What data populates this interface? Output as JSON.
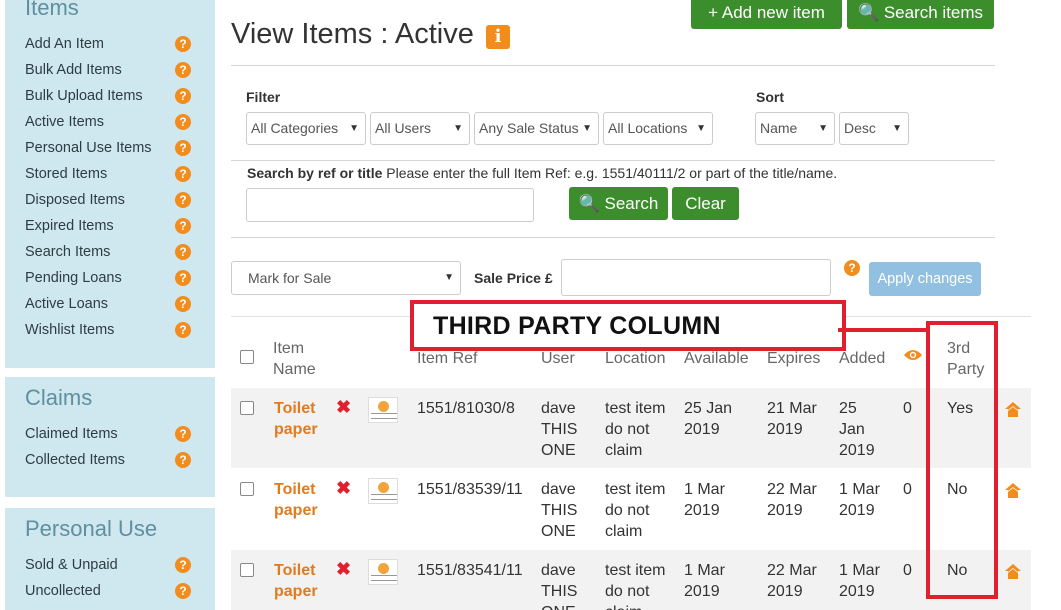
{
  "sidebar": {
    "items_title": "Items",
    "items": [
      "Add An Item",
      "Bulk Add Items",
      "Bulk Upload Items",
      "Active Items",
      "Personal Use Items",
      "Stored Items",
      "Disposed Items",
      "Expired Items",
      "Search Items",
      "Pending Loans",
      "Active Loans",
      "Wishlist Items"
    ],
    "claims_title": "Claims",
    "claims": [
      "Claimed Items",
      "Collected Items"
    ],
    "personal_title": "Personal Use",
    "personal": [
      "Sold & Unpaid",
      "Uncollected"
    ],
    "help_glyph": "?"
  },
  "header": {
    "title": "View Items : Active",
    "info_glyph": "i",
    "add_button": "+ Add new item",
    "search_button": "🔍 Search items"
  },
  "filter": {
    "label": "Filter",
    "categories": "All Categories",
    "users": "All Users",
    "sale_status": "Any Sale Status",
    "locations": "All Locations"
  },
  "sort": {
    "label": "Sort",
    "field": "Name",
    "direction": "Desc"
  },
  "search": {
    "label": "Search by ref or title",
    "hint": " Please enter the full Item Ref: e.g. 1551/40111/2 or part of the title/name.",
    "value": "",
    "search_button": "🔍 Search",
    "clear_button": "Clear"
  },
  "bulk": {
    "action": "Mark for Sale",
    "price_label": "Sale Price £",
    "price_value": "",
    "apply_button": "Apply changes"
  },
  "table": {
    "headers": {
      "name": [
        "Item",
        "Name"
      ],
      "ref": "Item Ref",
      "user": "User",
      "location": "Location",
      "available": "Available",
      "expires": "Expires",
      "added": "Added",
      "third_party": [
        "3rd",
        "Party"
      ]
    },
    "rows": [
      {
        "name": [
          "Toilet",
          "paper"
        ],
        "ref": "1551/81030/8",
        "user": [
          "dave",
          "THIS",
          "ONE"
        ],
        "location": [
          "test item",
          "do not",
          "claim"
        ],
        "available": [
          "25 Jan",
          "2019"
        ],
        "expires": [
          "21 Mar",
          "2019"
        ],
        "added": [
          "25",
          "Jan",
          "2019"
        ],
        "views": "0",
        "third_party": "Yes"
      },
      {
        "name": [
          "Toilet",
          "paper"
        ],
        "ref": "1551/83539/11",
        "user": [
          "dave",
          "THIS",
          "ONE"
        ],
        "location": [
          "test item",
          "do not",
          "claim"
        ],
        "available": [
          "1 Mar",
          "2019"
        ],
        "expires": [
          "22 Mar",
          "2019"
        ],
        "added": [
          "1 Mar",
          "2019"
        ],
        "views": "0",
        "third_party": "No"
      },
      {
        "name": [
          "Toilet",
          "paper"
        ],
        "ref": "1551/83541/11",
        "user": [
          "dave",
          "THIS",
          "ONE"
        ],
        "location": [
          "test item",
          "do not",
          "claim"
        ],
        "available": [
          "1 Mar",
          "2019"
        ],
        "expires": [
          "22 Mar",
          "2019"
        ],
        "added": [
          "1 Mar",
          "2019"
        ],
        "views": "0",
        "third_party": "No"
      }
    ],
    "delete_glyph": "✖"
  },
  "annotation": {
    "label": "THIRD PARTY COLUMN",
    "color": "#e0202e"
  },
  "colors": {
    "accent_orange": "#f28c1c",
    "green": "#3c8e2c",
    "sidebar_bg": "#cfe7ee"
  }
}
